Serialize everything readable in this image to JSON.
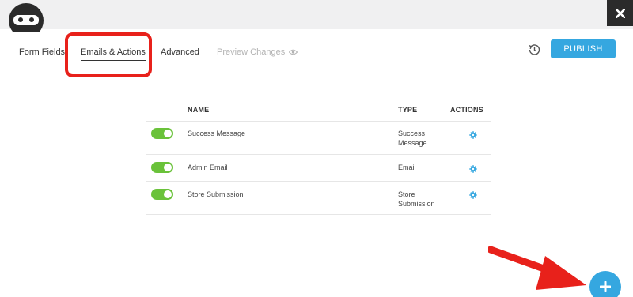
{
  "tabs": {
    "form_fields": "Form Fields",
    "emails_actions": "Emails & Actions",
    "advanced": "Advanced",
    "preview_changes": "Preview Changes"
  },
  "header": {
    "publish_label": "PUBLISH"
  },
  "table": {
    "headers": {
      "name": "NAME",
      "type": "TYPE",
      "actions": "ACTIONS"
    },
    "rows": [
      {
        "enabled": true,
        "name": "Success Message",
        "type_line1": "Success",
        "type_line2": "Message"
      },
      {
        "enabled": true,
        "name": "Admin Email",
        "type_line1": "Email",
        "type_line2": ""
      },
      {
        "enabled": true,
        "name": "Store Submission",
        "type_line1": "Store",
        "type_line2": "Submission"
      }
    ]
  },
  "icons": {
    "close": "close-icon",
    "logo": "ninja-logo-icon",
    "preview": "eye-icon",
    "history": "history-icon",
    "settings": "gear-icon",
    "add": "plus-icon"
  },
  "colors": {
    "accent": "#35a7e0",
    "toggle_on": "#6ac23a",
    "annotation": "#e8211b"
  }
}
